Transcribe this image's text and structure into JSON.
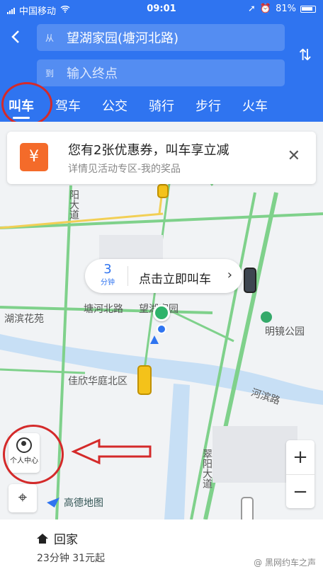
{
  "status_bar": {
    "carrier": "中国移动",
    "time": "09:01",
    "battery": "81%"
  },
  "header": {
    "from_tag": "从",
    "from_value": "望湖家园(塘河北路)",
    "to_tag": "到",
    "to_placeholder": "输入终点"
  },
  "tabs": [
    {
      "label": "叫车",
      "active": true
    },
    {
      "label": "驾车",
      "active": false
    },
    {
      "label": "公交",
      "active": false
    },
    {
      "label": "骑行",
      "active": false
    },
    {
      "label": "步行",
      "active": false
    },
    {
      "label": "火车",
      "active": false
    }
  ],
  "coupon": {
    "title": "您有2张优惠券，叫车享立减",
    "subtitle": "详情见活动专区-我的奖品",
    "icon_glyph": "¥"
  },
  "bubble": {
    "minutes": "3",
    "unit": "分钟",
    "action": "点击立即叫车"
  },
  "map_labels": {
    "road1": "塘河北路",
    "poi_start": "望湖家园",
    "area1": "湖滨花苑",
    "park": "明镜公园",
    "poi2": "佳欣华庭北区",
    "road2": "河滨路",
    "road3": "阳大道",
    "road4": "翠阳大道"
  },
  "controls": {
    "personal_center": "个人中心",
    "zoom_in": "+",
    "zoom_out": "−",
    "map_logo": "高德地图"
  },
  "bottom": {
    "destination": "回家",
    "eta": "23分钟 31元起",
    "watermark": "@ 黑网约车之声"
  },
  "colors": {
    "primary": "#2f74f0",
    "annotation_red": "#d42a2a",
    "coupon_orange": "#f46b2a"
  }
}
